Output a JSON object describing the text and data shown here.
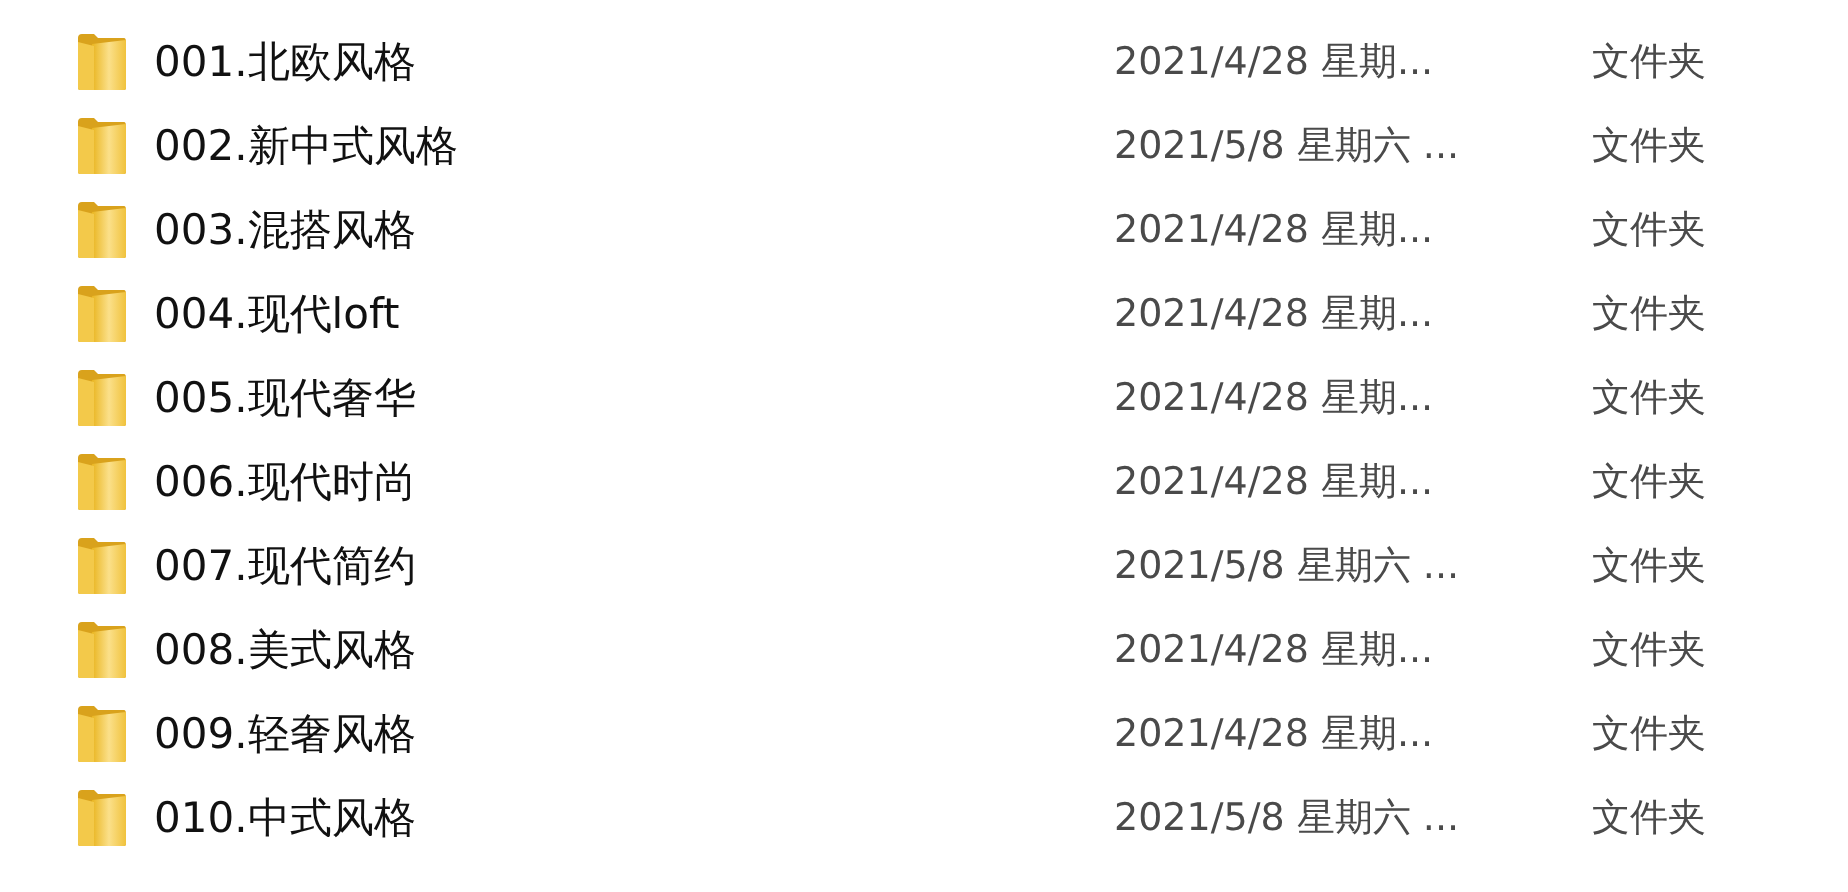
{
  "files": [
    {
      "name": "001.北欧风格",
      "modified": "2021/4/28 星期...",
      "type": "文件夹"
    },
    {
      "name": "002.新中式风格",
      "modified": "2021/5/8 星期六 ...",
      "type": "文件夹"
    },
    {
      "name": "003.混搭风格",
      "modified": "2021/4/28 星期...",
      "type": "文件夹"
    },
    {
      "name": "004.现代loft",
      "modified": "2021/4/28 星期...",
      "type": "文件夹"
    },
    {
      "name": "005.现代奢华",
      "modified": "2021/4/28 星期...",
      "type": "文件夹"
    },
    {
      "name": "006.现代时尚",
      "modified": "2021/4/28 星期...",
      "type": "文件夹"
    },
    {
      "name": "007.现代简约",
      "modified": "2021/5/8 星期六 ...",
      "type": "文件夹"
    },
    {
      "name": "008.美式风格",
      "modified": "2021/4/28 星期...",
      "type": "文件夹"
    },
    {
      "name": "009.轻奢风格",
      "modified": "2021/4/28 星期...",
      "type": "文件夹"
    },
    {
      "name": "010.中式风格",
      "modified": "2021/5/8 星期六 ...",
      "type": "文件夹"
    }
  ]
}
